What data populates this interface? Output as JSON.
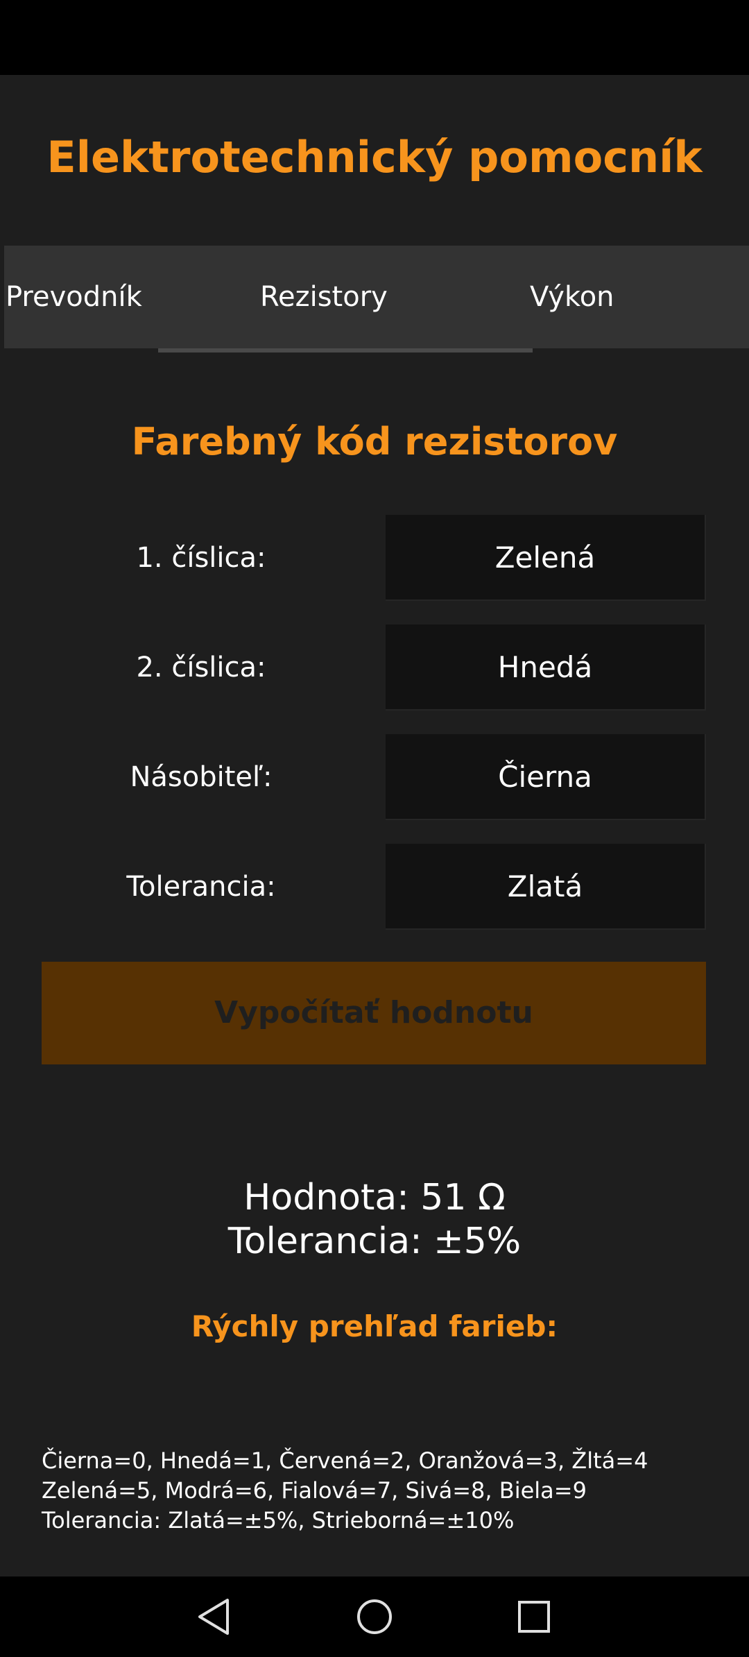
{
  "app": {
    "title": "Elektrotechnický pomocník"
  },
  "tabs": [
    {
      "label": "Prevodník",
      "selected": false
    },
    {
      "label": "Rezistory",
      "selected": true
    },
    {
      "label": "Výkon",
      "selected": false
    }
  ],
  "resistor": {
    "section_title": "Farebný kód rezistorov",
    "rows": [
      {
        "label": "1. číslica:",
        "value": "Zelená"
      },
      {
        "label": "2. číslica:",
        "value": "Hnedá"
      },
      {
        "label": "Násobiteľ:",
        "value": "Čierna"
      },
      {
        "label": "Tolerancia:",
        "value": "Zlatá"
      }
    ],
    "calculate_button": "Vypočítať hodnotu"
  },
  "result": {
    "value": "Hodnota: 51 Ω",
    "tolerance": "Tolerancia: ±5%"
  },
  "overview": {
    "title": "Rýchly prehľad farieb:",
    "lines": [
      "Čierna=0, Hnedá=1, Červená=2, Oranžová=3, Žltá=4",
      "Zelená=5, Modrá=6, Fialová=7, Sivá=8, Biela=9",
      "Tolerancia: Zlatá=±5%, Strieborná=±10%"
    ]
  },
  "navigation": {
    "back_icon": "triangle-back-icon",
    "home_icon": "circle-home-icon",
    "recent_icon": "square-recents-icon"
  },
  "colors": {
    "accent": "#f7941d",
    "background": "#1e1e1e",
    "tab_bar": "#333333",
    "select_background": "#121212",
    "button_background": "#573103"
  }
}
